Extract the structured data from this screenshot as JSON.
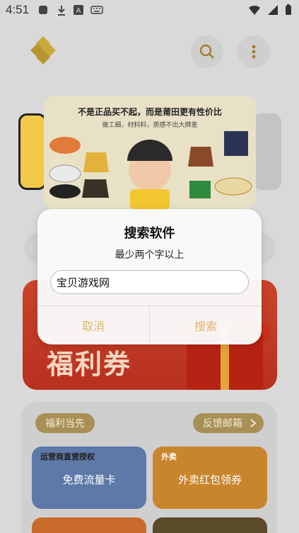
{
  "status_bar": {
    "time": "4:51",
    "icons_left": [
      "square-icon",
      "download-icon",
      "a-icon",
      "keyboard-icon"
    ],
    "icons_right": [
      "wifi-icon",
      "signal-icon",
      "battery-icon"
    ]
  },
  "app_bar": {
    "logo": "app-logo",
    "search_icon": "search-icon",
    "menu_icon": "more-vert-icon"
  },
  "banner": {
    "headline": "不是正品买不起，而是莆田更有性价比",
    "sub": "做工细，材料料，质感不出大牌差"
  },
  "promo": {
    "text": "福利券"
  },
  "panel": {
    "left_pill": "福利当先",
    "right_pill": "反馈邮箱",
    "tiles": [
      {
        "tag": "运营商直营授权",
        "label": "免费流量卡"
      },
      {
        "tag": "外卖",
        "label": "外卖红包领券"
      }
    ]
  },
  "dialog": {
    "title": "搜索软件",
    "message": "最少两个字以上",
    "input_value": "宝贝游戏网",
    "cancel_label": "取消",
    "search_label": "搜索"
  },
  "colors": {
    "accent": "#e0b86c",
    "pill": "#a88f55",
    "promo_red": "#c9442a"
  }
}
